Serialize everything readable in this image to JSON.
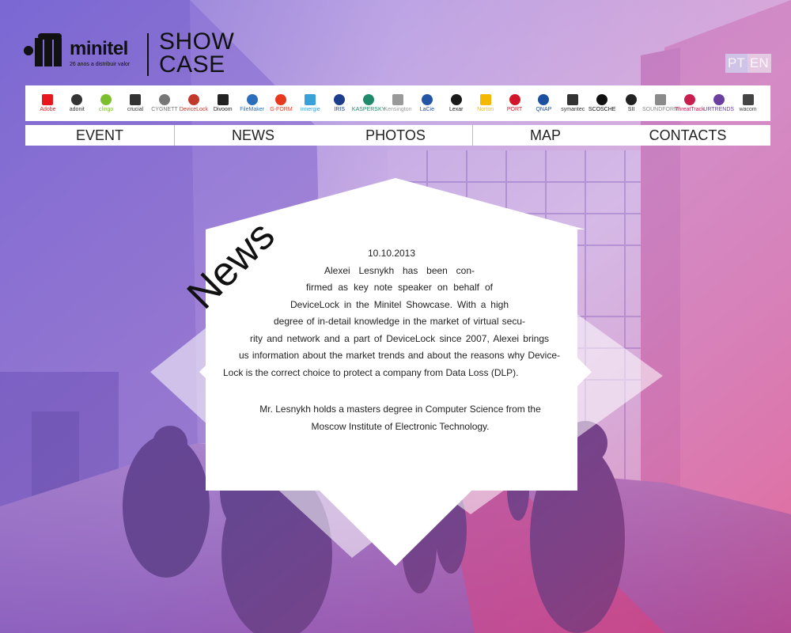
{
  "brand": {
    "name": "minitel",
    "tagline": "26 anos a distribuir valor",
    "show_line1": "SHOW",
    "show_line2": "CASE"
  },
  "languages": [
    "PT",
    "EN"
  ],
  "sponsors": [
    {
      "label": "Adobe",
      "color": "#e8161d"
    },
    {
      "label": "adonit",
      "color": "#333333"
    },
    {
      "label": "clingo",
      "color": "#7cbf2e"
    },
    {
      "label": "crucial",
      "color": "#333333"
    },
    {
      "label": "CYGNETT",
      "color": "#777777"
    },
    {
      "label": "DeviceLock",
      "color": "#c0392b"
    },
    {
      "label": "Divoom",
      "color": "#222222"
    },
    {
      "label": "FileMaker",
      "color": "#2a6ebb"
    },
    {
      "label": "G-FORM",
      "color": "#e8381d"
    },
    {
      "label": "innergie",
      "color": "#3aa0d8"
    },
    {
      "label": "IRIS",
      "color": "#1d3c8c"
    },
    {
      "label": "KASPERSKY",
      "color": "#1e8a6b"
    },
    {
      "label": "Kensington",
      "color": "#999999"
    },
    {
      "label": "LaCie",
      "color": "#2454a4"
    },
    {
      "label": "Lexar",
      "color": "#1a1a1a"
    },
    {
      "label": "Norton",
      "color": "#f5b800"
    },
    {
      "label": "PORT",
      "color": "#d1162b"
    },
    {
      "label": "QNAP",
      "color": "#1b4fa0"
    },
    {
      "label": "symantec",
      "color": "#333333"
    },
    {
      "label": "SCOSCHE",
      "color": "#111111"
    },
    {
      "label": "SII",
      "color": "#222222"
    },
    {
      "label": "SOUNDFORM",
      "color": "#8a8a8a"
    },
    {
      "label": "ThreatTrack",
      "color": "#c81f4f"
    },
    {
      "label": "URTRENDS",
      "color": "#6b3fa0"
    },
    {
      "label": "wacom",
      "color": "#444444"
    }
  ],
  "nav": [
    "EVENT",
    "NEWS",
    "PHOTOS",
    "MAP",
    "CONTACTS"
  ],
  "news": {
    "heading": "News",
    "date": "10.10.2013",
    "lines": [
      "Alexei Lesnykh has been con-",
      "firmed as key note speaker on behalf of",
      "DeviceLock in the Minitel Showcase. With a high",
      "degree of in-detail knowledge in the market of virtual secu-",
      "rity and network and a part of DeviceLock since 2007, Alexei brings",
      "us information about the market trends and about the reasons why Device-",
      "Lock is the correct choice to protect a company from Data Loss (DLP).",
      "Mr. Lesnykh holds a masters degree in Computer Science from the",
      "Moscow Institute of Electronic Technology."
    ]
  }
}
